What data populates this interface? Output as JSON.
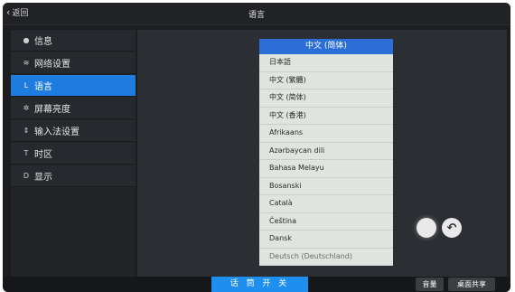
{
  "topbar": {
    "back_label": "返回",
    "title": "语言"
  },
  "sidebar": {
    "items": [
      {
        "label": "信息",
        "icon": "info-icon",
        "glyph": "●",
        "active": false
      },
      {
        "label": "网络设置",
        "icon": "wifi-icon",
        "glyph": "≋",
        "active": false
      },
      {
        "label": "语言",
        "icon": "language-icon",
        "glyph": "L",
        "active": true
      },
      {
        "label": "屏幕亮度",
        "icon": "brightness-icon",
        "glyph": "✲",
        "active": false
      },
      {
        "label": "输入法设置",
        "icon": "input-icon",
        "glyph": "⇕",
        "active": false
      },
      {
        "label": "时区",
        "icon": "timezone-icon",
        "glyph": "T",
        "active": false
      },
      {
        "label": "显示",
        "icon": "display-icon",
        "glyph": "D",
        "active": false
      }
    ]
  },
  "picker": {
    "selected": "中文 (简体)",
    "options": [
      "日本語",
      "中文 (繁體)",
      "中文 (简体)",
      "中文 (香港)",
      "Afrikaans",
      "Azərbaycan dili",
      "Bahasa Melayu",
      "Bosanski",
      "Català",
      "Čeština",
      "Dansk"
    ],
    "partial_option": "Deutsch (Deutschland)"
  },
  "bottombar": {
    "voice_label": "话 筒 开 关",
    "volume_label": "音量",
    "share_label": "桌面共享"
  },
  "colors": {
    "accent": "#1e7be0",
    "picker_header": "#2b6fd6",
    "voice_button": "#1e8ff0",
    "background": "#1b1d20"
  }
}
